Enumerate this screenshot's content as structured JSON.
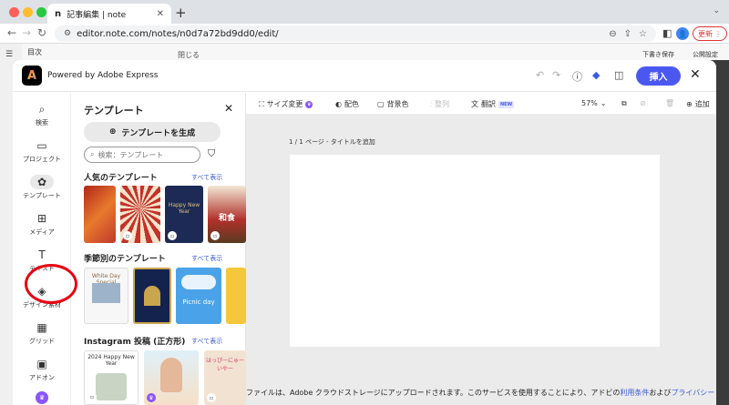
{
  "browser": {
    "tab_title": "記事編集 | note",
    "tab_favicon": "n",
    "url": "editor.note.com/notes/n0d7a72bd9dd0/edit/",
    "update_label": "更新",
    "avatar_initial": "👤"
  },
  "note_editor": {
    "toc_label": "目次",
    "close_label": "閉じる",
    "draft_label": "下書き保存",
    "publish_label": "公開設定"
  },
  "modal": {
    "logo_letter": "A",
    "powered_by": "Powered by Adobe Express",
    "insert_label": "挿入"
  },
  "rail": {
    "items": [
      {
        "label": "検索",
        "icon": "search-icon",
        "glyph": "⌕"
      },
      {
        "label": "プロジェクト",
        "icon": "folder-icon",
        "glyph": "▭"
      },
      {
        "label": "テンプレート",
        "icon": "template-icon",
        "glyph": "✿"
      },
      {
        "label": "メディア",
        "icon": "media-icon",
        "glyph": "⊞"
      },
      {
        "label": "テキスト",
        "icon": "text-icon",
        "glyph": "T"
      },
      {
        "label": "デザイン素材",
        "icon": "shapes-icon",
        "glyph": "◈"
      },
      {
        "label": "グリッド",
        "icon": "grid-icon",
        "glyph": "▦"
      },
      {
        "label": "アドオン",
        "icon": "addon-icon",
        "glyph": "▣"
      }
    ],
    "active_index": 2
  },
  "panel": {
    "title": "テンプレート",
    "generate_label": "テンプレートを生成",
    "search_placeholder": "検索：テンプレート",
    "sections": [
      {
        "title": "人気のテンプレート",
        "see_all": "すべて表示"
      },
      {
        "title": "季節別のテンプレート",
        "see_all": "すべて表示"
      },
      {
        "title": "Instagram 投稿 (正方形)",
        "see_all": "すべて表示"
      }
    ],
    "thumb_texts": {
      "seasonal_1": "White Day Special",
      "seasonal_3": "Picnic day",
      "insta_1": "2024 Happy New Year",
      "insta_3": "はっぴーにゅーいやー",
      "popular_3": "Happy New Year",
      "popular_4": "和食"
    }
  },
  "toolbar": {
    "resize": "サイズ変更",
    "color": "配色",
    "background": "背景色",
    "arrange": "整列",
    "translate": "翻訳",
    "new_badge": "NEW",
    "zoom": "57%",
    "add": "追加"
  },
  "canvas": {
    "page_label": "1 / 1 ページ - タイトルを追加",
    "footer_text": "ファイルは、Adobe クラウドストレージにアップロードされます。このサービスを使用することにより、アドビの",
    "terms_link": "利用条件",
    "and": "および",
    "privacy_link": "プライバシー"
  },
  "colors": {
    "accent": "#4b58f0",
    "highlight": "#e60012",
    "premium": "#8c54ff"
  }
}
